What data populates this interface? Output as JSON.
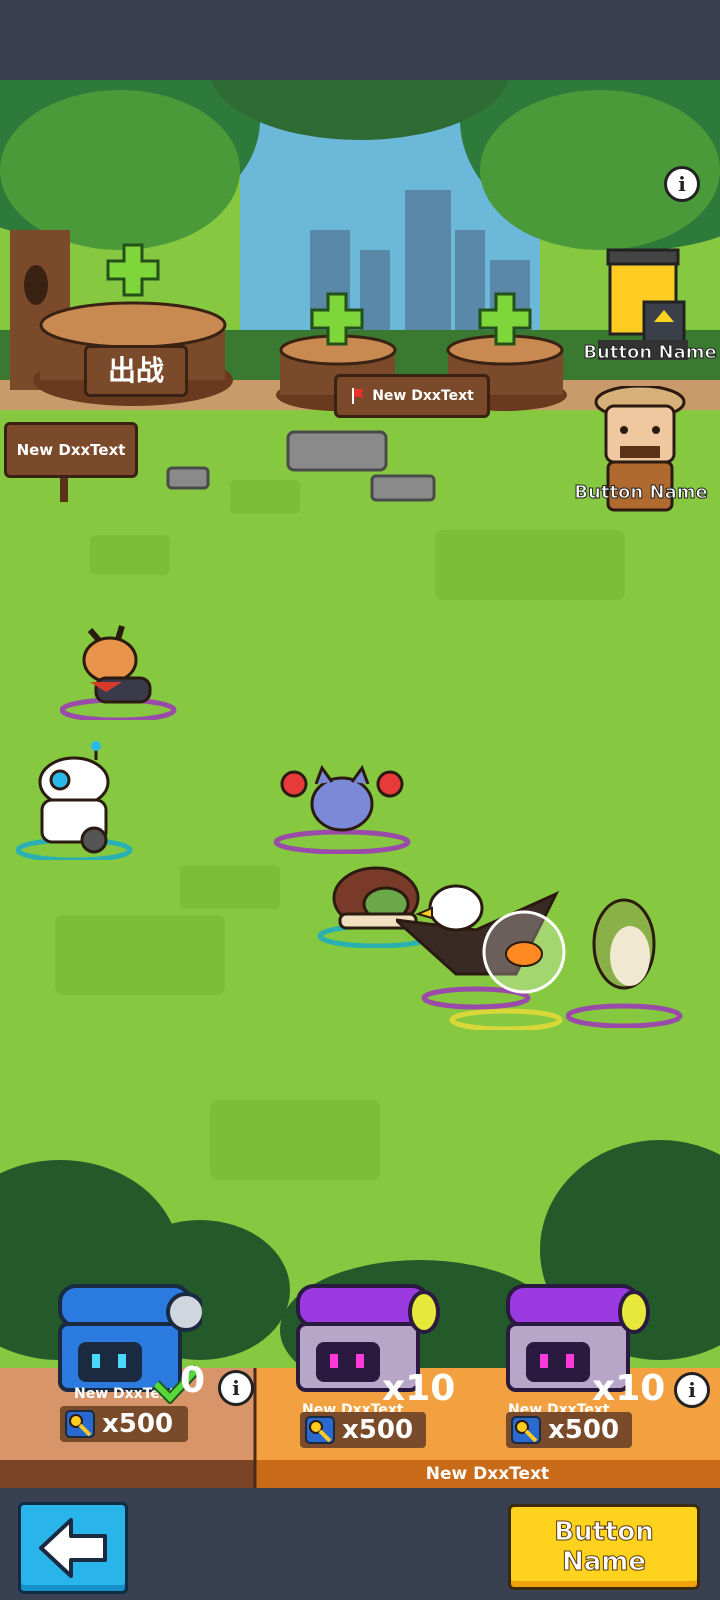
{
  "topbar": {},
  "scene": {
    "stump_left_label": "出战",
    "stump_center_label": "New DxxText",
    "left_sign_label": "New DxxText",
    "shop_button_label": "Button Name",
    "npc_button_label": "Button Name"
  },
  "chests": [
    {
      "label": "New DxxText",
      "count": "0",
      "price": "x500",
      "color": "blue",
      "claimed": true
    },
    {
      "label": "New DxxText",
      "count": "x10",
      "price": "x500",
      "color": "purple",
      "claimed": false
    },
    {
      "label": "New DxxText",
      "count": "x10",
      "price": "x500",
      "color": "purple",
      "claimed": false
    }
  ],
  "panel": {
    "footer_label": "New DxxText"
  },
  "nav": {
    "main_button_label": "Button\nName"
  },
  "colors": {
    "grass": "#86c940",
    "wood": "#7a4a2a",
    "accent_yellow": "#ffd21e",
    "accent_blue": "#29b4ea"
  }
}
